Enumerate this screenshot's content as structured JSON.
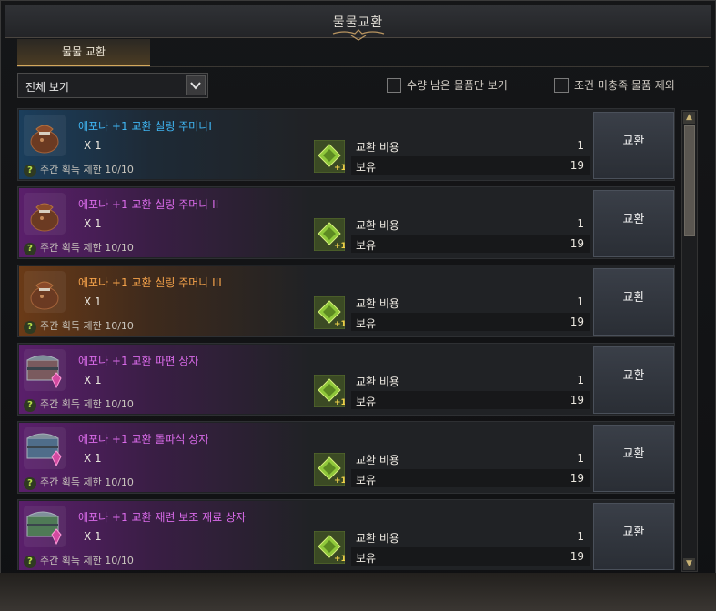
{
  "window": {
    "title": "물물교환"
  },
  "tab": {
    "label": "물물 교환"
  },
  "filter": {
    "selected": "전체 보기",
    "dropdown_icon": "chevron-down-icon"
  },
  "checkboxes": [
    {
      "label": "수량 남은 물품만 보기",
      "checked": false
    },
    {
      "label": "조건 미충족 물품 제외",
      "checked": false
    }
  ],
  "colors": {
    "accent": "#d3a85c",
    "name_blue": "#3fb5f2",
    "name_purple": "#d86ae8",
    "name_orange": "#f5a24a"
  },
  "items": [
    {
      "name": "에포나 +1 교환 실링 주머니I",
      "tier": "blue",
      "icon": "pouch-icon",
      "qty": "X 1",
      "limit": "주간 획득 제한 10/10",
      "cost_label": "교환 비용",
      "cost": "1",
      "owned_label": "보유",
      "owned": "19",
      "button": "교환"
    },
    {
      "name": "에포나 +1 교환 실링 주머니 II",
      "tier": "purple",
      "icon": "pouch-icon",
      "qty": "X 1",
      "limit": "주간 획득 제한 10/10",
      "cost_label": "교환 비용",
      "cost": "1",
      "owned_label": "보유",
      "owned": "19",
      "button": "교환"
    },
    {
      "name": "에포나 +1 교환 실링 주머니 III",
      "tier": "orange",
      "icon": "pouch-icon",
      "qty": "X 1",
      "limit": "주간 획득 제한 10/10",
      "cost_label": "교환 비용",
      "cost": "1",
      "owned_label": "보유",
      "owned": "19",
      "button": "교환"
    },
    {
      "name": "에포나 +1 교환 파편 상자",
      "tier": "purple",
      "icon": "chest-icon",
      "qty": "X 1",
      "limit": "주간 획득 제한 10/10",
      "cost_label": "교환 비용",
      "cost": "1",
      "owned_label": "보유",
      "owned": "19",
      "button": "교환"
    },
    {
      "name": "에포나 +1 교환 돌파석 상자",
      "tier": "purple",
      "icon": "chest-icon",
      "qty": "X 1",
      "limit": "주간 획득 제한 10/10",
      "cost_label": "교환 비용",
      "cost": "1",
      "owned_label": "보유",
      "owned": "19",
      "button": "교환"
    },
    {
      "name": "에포나 +1 교환 재련 보조 재료 상자",
      "tier": "purple",
      "icon": "chest-icon",
      "qty": "X 1",
      "limit": "주간 획득 제한 10/10",
      "cost_label": "교환 비용",
      "cost": "1",
      "owned_label": "보유",
      "owned": "19",
      "button": "교환"
    }
  ]
}
